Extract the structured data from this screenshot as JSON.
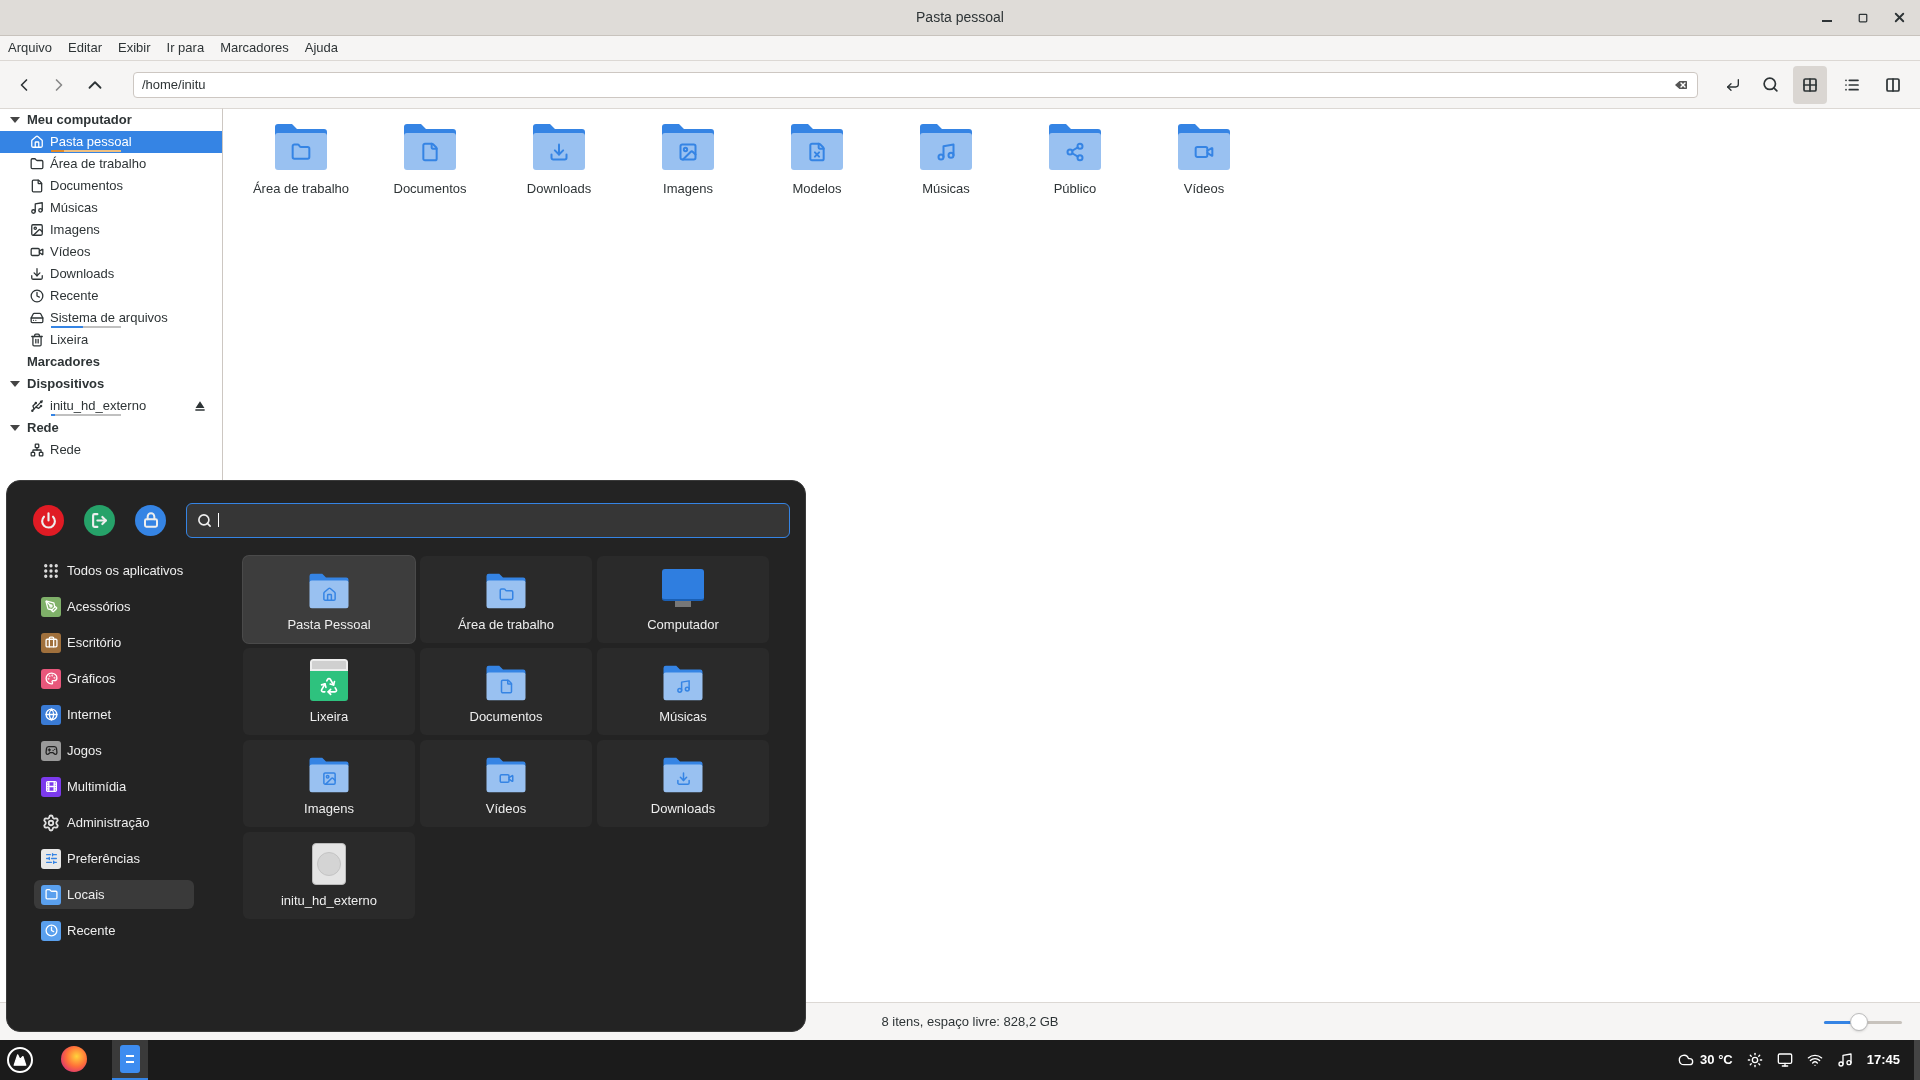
{
  "window": {
    "title": "Pasta pessoal"
  },
  "menubar": [
    "Arquivo",
    "Editar",
    "Exibir",
    "Ir para",
    "Marcadores",
    "Ajuda"
  ],
  "toolbar": {
    "path": "/home/initu",
    "view_modes": [
      {
        "selected": true
      },
      {
        "selected": false
      },
      {
        "selected": false
      }
    ]
  },
  "sidebar": [
    {
      "label": "Meu computador",
      "expanded": true,
      "items": [
        {
          "label": "Pasta pessoal",
          "selected": true,
          "level": 0.18
        },
        {
          "label": "Área de trabalho",
          "selected": false
        },
        {
          "label": "Documentos",
          "selected": false
        },
        {
          "label": "Músicas",
          "selected": false
        },
        {
          "label": "Imagens",
          "selected": false
        },
        {
          "label": "Vídeos",
          "selected": false
        },
        {
          "label": "Downloads",
          "selected": false
        },
        {
          "label": "Recente",
          "selected": false
        },
        {
          "label": "Sistema de arquivos",
          "selected": false,
          "level": 0.45
        },
        {
          "label": "Lixeira",
          "selected": false
        }
      ]
    },
    {
      "label": "Marcadores"
    },
    {
      "label": "Dispositivos",
      "expanded": true,
      "items": [
        {
          "label": "initu_hd_externo",
          "selected": false,
          "level": 0.05,
          "eject": true
        }
      ]
    },
    {
      "label": "Rede",
      "expanded": true,
      "items": [
        {
          "label": "Rede",
          "selected": false
        }
      ]
    }
  ],
  "folders": [
    {
      "label": "Área de trabalho"
    },
    {
      "label": "Documentos"
    },
    {
      "label": "Downloads"
    },
    {
      "label": "Imagens"
    },
    {
      "label": "Modelos"
    },
    {
      "label": "Músicas"
    },
    {
      "label": "Público"
    },
    {
      "label": "Vídeos"
    }
  ],
  "status_bar": {
    "text": "8 itens, espaço livre: 828,2 GB",
    "zoom": {
      "level": 0.45
    }
  },
  "app_menu": {
    "categories": [
      {
        "label": "Todos os aplicativos",
        "selected": false
      },
      {
        "label": "Acessórios",
        "selected": false
      },
      {
        "label": "Escritório",
        "selected": false
      },
      {
        "label": "Gráficos",
        "selected": false
      },
      {
        "label": "Internet",
        "selected": false
      },
      {
        "label": "Jogos",
        "selected": false
      },
      {
        "label": "Multimídia",
        "selected": false
      },
      {
        "label": "Administração",
        "selected": false
      },
      {
        "label": "Preferências",
        "selected": false
      },
      {
        "label": "Locais",
        "selected": true
      },
      {
        "label": "Recente",
        "selected": false
      }
    ],
    "places": [
      {
        "label": "Pasta Pessoal",
        "selected": true
      },
      {
        "label": "Área de trabalho",
        "selected": false
      },
      {
        "label": "Computador",
        "selected": false
      },
      {
        "label": "Lixeira",
        "selected": false
      },
      {
        "label": "Documentos",
        "selected": false
      },
      {
        "label": "Músicas",
        "selected": false
      },
      {
        "label": "Imagens",
        "selected": false
      },
      {
        "label": "Vídeos",
        "selected": false
      },
      {
        "label": "Downloads",
        "selected": false
      },
      {
        "label": "initu_hd_externo",
        "selected": false
      }
    ]
  },
  "taskbar": {
    "apps": [
      {
        "active": false
      },
      {
        "active": true
      }
    ],
    "weather": "30 °C",
    "clock": "17:45"
  }
}
